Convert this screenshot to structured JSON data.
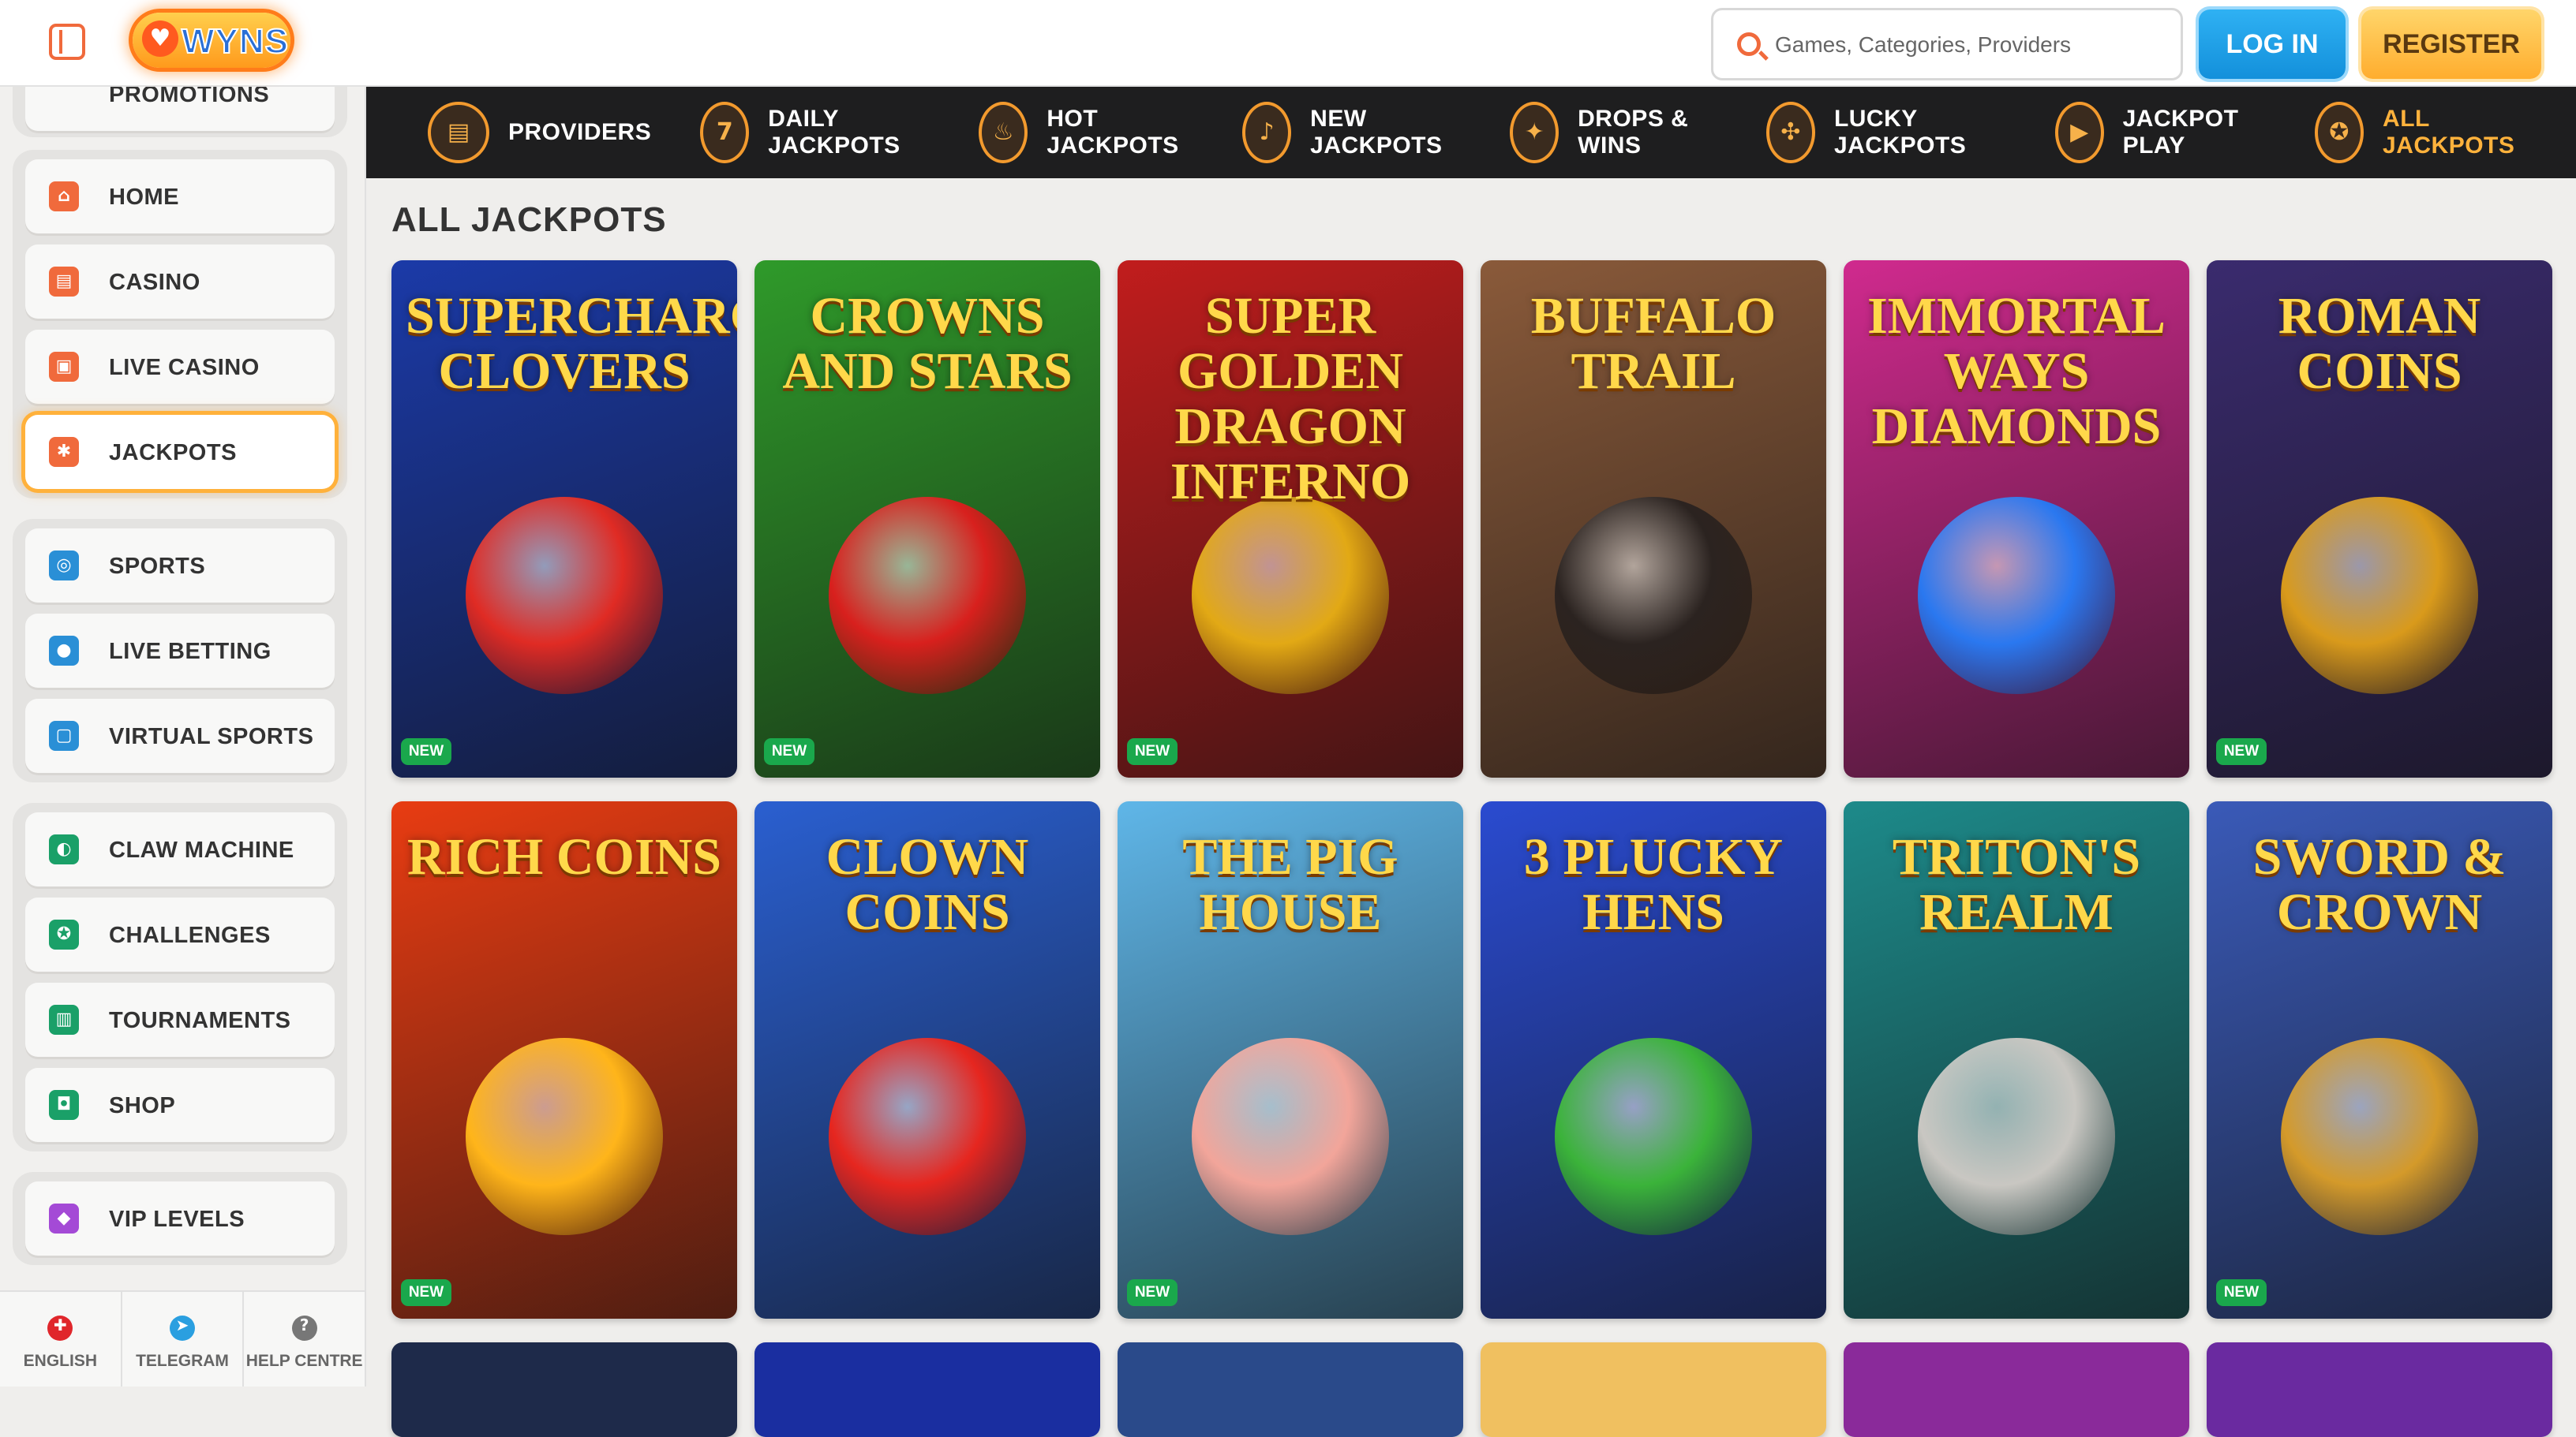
{
  "header": {
    "logo_text": "WYNS",
    "search_placeholder": "Games, Categories, Providers",
    "login_label": "LOG IN",
    "register_label": "REGISTER"
  },
  "sidebar": {
    "partial_item": "PROMOTIONS",
    "groups": [
      [
        {
          "label": "HOME",
          "icon": "home-icon"
        },
        {
          "label": "CASINO",
          "icon": "slot-machine-icon"
        },
        {
          "label": "LIVE CASINO",
          "icon": "live-casino-icon"
        },
        {
          "label": "JACKPOTS",
          "icon": "jackpot-icon",
          "active": true
        }
      ],
      [
        {
          "label": "SPORTS",
          "icon": "sports-ball-icon"
        },
        {
          "label": "LIVE BETTING",
          "icon": "live-badge-icon"
        },
        {
          "label": "VIRTUAL SPORTS",
          "icon": "virtual-sports-icon"
        }
      ],
      [
        {
          "label": "CLAW MACHINE",
          "icon": "claw-icon"
        },
        {
          "label": "CHALLENGES",
          "icon": "challenge-icon"
        },
        {
          "label": "TOURNAMENTS",
          "icon": "podium-icon"
        },
        {
          "label": "SHOP",
          "icon": "shop-bag-icon"
        }
      ],
      [
        {
          "label": "VIP LEVELS",
          "icon": "diamond-icon"
        }
      ]
    ],
    "footer": [
      {
        "label": "ENGLISH",
        "icon": "canada-flag-icon"
      },
      {
        "label": "TELEGRAM",
        "icon": "telegram-icon"
      },
      {
        "label": "HELP CENTRE",
        "icon": "help-icon"
      }
    ]
  },
  "categories": [
    {
      "label": "PROVIDERS",
      "icon": "providers-icon"
    },
    {
      "label": "DAILY JACKPOTS",
      "icon": "calendar-icon"
    },
    {
      "label": "HOT JACKPOTS",
      "icon": "hot-jackpot-icon"
    },
    {
      "label": "NEW JACKPOTS",
      "icon": "bell-icon"
    },
    {
      "label": "DROPS & WINS",
      "icon": "drops-wins-icon"
    },
    {
      "label": "LUCKY JACKPOTS",
      "icon": "clover-icon"
    },
    {
      "label": "JACKPOT PLAY",
      "icon": "play-icon"
    },
    {
      "label": "ALL JACKPOTS",
      "icon": "all-jackpots-icon",
      "active": true
    }
  ],
  "main": {
    "section_title": "ALL JACKPOTS",
    "badge_label": "NEW",
    "games": [
      {
        "title": "SUPERCHARGED CLOVERS",
        "new": true,
        "bg": "#1b3aa8",
        "accent": "#e02b24"
      },
      {
        "title": "CROWNS AND STARS",
        "new": true,
        "bg": "#2f9a2a",
        "accent": "#d8201d"
      },
      {
        "title": "SUPER GOLDEN DRAGON INFERNO",
        "new": true,
        "bg": "#c11d1d",
        "accent": "#e2a915"
      },
      {
        "title": "BUFFALO TRAIL",
        "new": false,
        "bg": "#8a5a3a",
        "accent": "#2b2320"
      },
      {
        "title": "IMMORTAL WAYS DIAMONDS",
        "new": false,
        "bg": "#d02a8e",
        "accent": "#2a78f0"
      },
      {
        "title": "ROMAN COINS",
        "new": true,
        "bg": "#3a2b6e",
        "accent": "#d99a1b"
      },
      {
        "title": "RICH COINS",
        "new": true,
        "bg": "#e83c12",
        "accent": "#ffb51a"
      },
      {
        "title": "CLOWN COINS",
        "new": false,
        "bg": "#2a5fd0",
        "accent": "#e6261f"
      },
      {
        "title": "THE PIG HOUSE",
        "new": true,
        "bg": "#5fb6e8",
        "accent": "#f2a59a"
      },
      {
        "title": "3 PLUCKY HENS",
        "new": false,
        "bg": "#2a4bd0",
        "accent": "#3bb33a"
      },
      {
        "title": "TRITON'S REALM",
        "new": false,
        "bg": "#1d8a8a",
        "accent": "#c9c7c2"
      },
      {
        "title": "SWORD & CROWN",
        "new": true,
        "bg": "#3a5ab8",
        "accent": "#d49a2a"
      }
    ],
    "partial_row": [
      {
        "bg": "#1e2a4a"
      },
      {
        "bg": "#1a2ea0"
      },
      {
        "bg": "#2a4a8a"
      },
      {
        "bg": "#f0c060"
      },
      {
        "bg": "#8a2a9a"
      },
      {
        "bg": "#6a2aa0"
      }
    ]
  }
}
